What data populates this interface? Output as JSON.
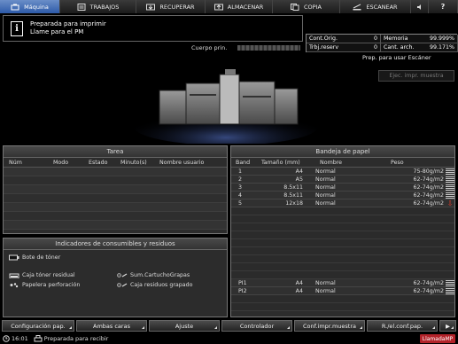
{
  "nav": {
    "tabs": [
      {
        "label": "Máquina",
        "icon": "machine-icon",
        "active": true
      },
      {
        "label": "TRABAJOS",
        "icon": "jobs-icon",
        "active": false
      },
      {
        "label": "RECUPERAR",
        "icon": "recall-icon",
        "active": false
      },
      {
        "label": "ALMACENAR",
        "icon": "store-icon",
        "active": false
      },
      {
        "label": "COPIA",
        "icon": "copy-icon",
        "active": false
      },
      {
        "label": "ESCANEAR",
        "icon": "scan-icon",
        "active": false
      },
      {
        "label": "",
        "icon": "speaker-icon",
        "active": false
      },
      {
        "label": "?",
        "icon": "help-icon",
        "active": false
      }
    ]
  },
  "status": {
    "line1": "Preparada para imprimir",
    "line2": "Llame para el PM",
    "cuerpo_label": "Cuerpo prin."
  },
  "counters": {
    "cont_orig_label": "Cont.Orig.",
    "cont_orig_value": "0",
    "memoria_label": "Memoria",
    "memoria_value": "99.999%",
    "trbj_reserv_label": "Trbj.reserv",
    "trbj_reserv_value": "0",
    "cant_arch_label": "Cant. arch.",
    "cant_arch_value": "99.171%"
  },
  "scanner_status": "Prep. para usar Escáner",
  "ejec_button": "Ejec. impr. muestra",
  "tarea": {
    "title": "Tarea",
    "columns": [
      "Núm",
      "Modo",
      "Estado",
      "Minuto(s)",
      "Nombre usuario"
    ]
  },
  "consumibles": {
    "title": "Indicadores de consumibles y residuos",
    "toner": "Bote de tóner",
    "caja_toner": "Caja tóner residual",
    "papelera": "Papelera perforación",
    "cartucho": "Sum.CartuchoGrapas",
    "caja_grapado": "Caja residuos grapado"
  },
  "bandeja": {
    "title": "Bandeja de papel",
    "columns": [
      "Band",
      "Tamaño (mm)",
      "Nombre",
      "Peso"
    ],
    "rows": [
      {
        "band": "1",
        "size": "A4",
        "name": "Normal",
        "weight": "75-80g/m2",
        "level": "full"
      },
      {
        "band": "2",
        "size": "A5",
        "name": "Normal",
        "weight": "62-74g/m2",
        "level": "full"
      },
      {
        "band": "3",
        "size": "8.5x11",
        "name": "Normal",
        "weight": "62-74g/m2",
        "level": "full"
      },
      {
        "band": "4",
        "size": "8.5x11",
        "name": "Normal",
        "weight": "62-74g/m2",
        "level": "full"
      },
      {
        "band": "5",
        "size": "12x18",
        "name": "Normal",
        "weight": "62-74g/m2",
        "level": "low"
      }
    ],
    "pi_rows": [
      {
        "band": "PI1",
        "size": "A4",
        "name": "Normal",
        "weight": "62-74g/m2",
        "level": "full"
      },
      {
        "band": "PI2",
        "size": "A4",
        "name": "Normal",
        "weight": "62-74g/m2",
        "level": "full"
      }
    ]
  },
  "bottom_buttons": [
    "Configuración pap.",
    "Ambas caras",
    "Ajuste",
    "Controlador",
    "Conf.impr.muestra",
    "R./el.conf.pap.",
    "▶"
  ],
  "statusline": {
    "time": "16:01",
    "message": "Preparada para recibir"
  },
  "footer_brand": "LlamadaMP",
  "colors": {
    "active_tab": "#2d5aa8",
    "warning": "#e03b2b",
    "footer": "#b3232a"
  }
}
